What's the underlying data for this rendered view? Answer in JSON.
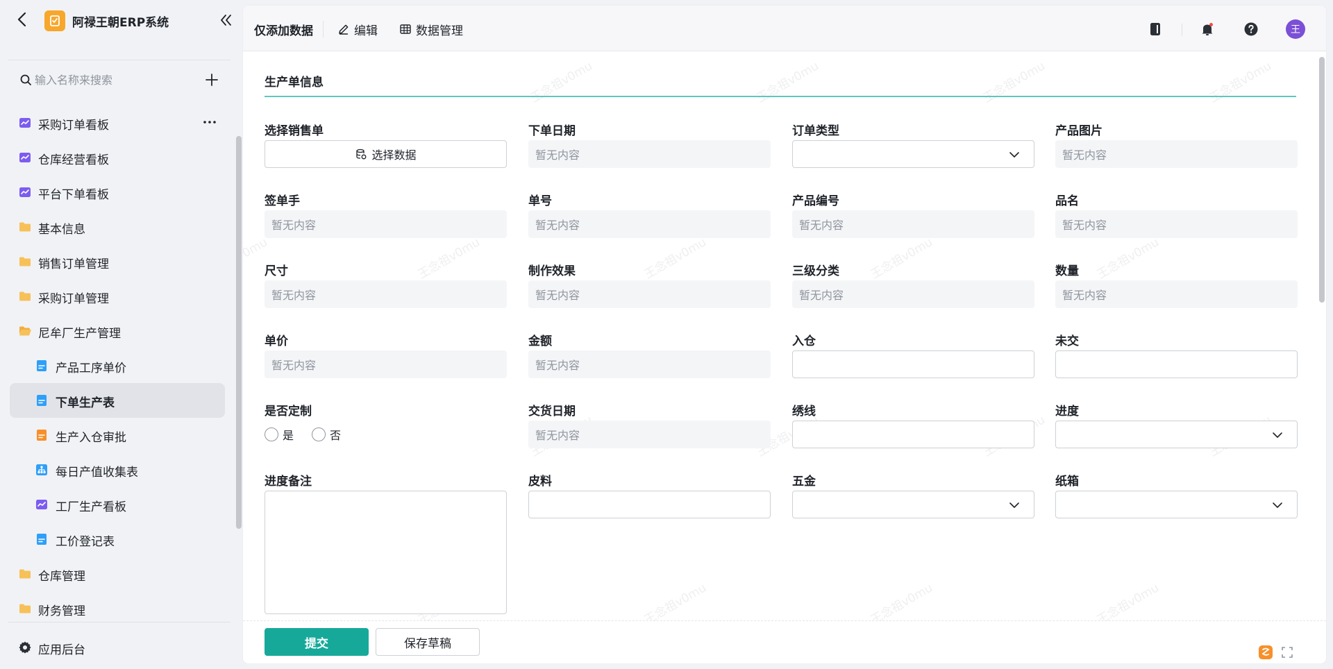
{
  "app": {
    "title": "阿禄王朝ERP系统"
  },
  "sidebar": {
    "search": {
      "placeholder": "输入名称来搜索"
    },
    "items": [
      {
        "label": "采购订单看板",
        "icon": "dashboard-icon"
      },
      {
        "label": "仓库经营看板",
        "icon": "dashboard-icon"
      },
      {
        "label": "平台下单看板",
        "icon": "dashboard-icon"
      },
      {
        "label": "基本信息",
        "icon": "folder-icon"
      },
      {
        "label": "销售订单管理",
        "icon": "folder-icon"
      },
      {
        "label": "采购订单管理",
        "icon": "folder-icon"
      },
      {
        "label": "尼牟厂生产管理",
        "icon": "folder-open-icon"
      },
      {
        "label": "产品工序单价",
        "icon": "form-icon"
      },
      {
        "label": "下单生产表",
        "icon": "form-icon",
        "active": true
      },
      {
        "label": "生产入仓审批",
        "icon": "approval-form-icon"
      },
      {
        "label": "每日产值收集表",
        "icon": "org-chart-icon"
      },
      {
        "label": "工厂生产看板",
        "icon": "dashboard-icon"
      },
      {
        "label": "工价登记表",
        "icon": "form-icon"
      },
      {
        "label": "仓库管理",
        "icon": "folder-icon"
      },
      {
        "label": "财务管理",
        "icon": "folder-icon"
      }
    ],
    "footer": {
      "label": "应用后台"
    }
  },
  "topbar": {
    "title": "仅添加数据",
    "edit_label": "编辑",
    "data_manage_label": "数据管理",
    "avatar_text": "王"
  },
  "form": {
    "section_title": "生产单信息",
    "empty_text": "暂无内容",
    "select_data_label": "选择数据",
    "fields": {
      "sales_order": "选择销售单",
      "order_date": "下单日期",
      "order_type": "订单类型",
      "product_image": "产品图片",
      "signer": "签单手",
      "order_no": "单号",
      "product_code": "产品编号",
      "product_name": "品名",
      "size": "尺寸",
      "effect": "制作效果",
      "category3": "三级分类",
      "quantity": "数量",
      "unit_price": "单价",
      "amount": "金额",
      "in_stock": "入仓",
      "undelivered": "未交",
      "customized": "是否定制",
      "delivery_date": "交货日期",
      "embroidery": "绣线",
      "progress": "进度",
      "progress_note": "进度备注",
      "leather": "皮料",
      "hardware": "五金",
      "carton": "纸箱"
    },
    "radio_yes": "是",
    "radio_no": "否",
    "submit_label": "提交",
    "draft_label": "保存草稿"
  },
  "watermark_text": "王念祖v0mu",
  "colors": {
    "accent": "#16a99a",
    "section_line": "#5fc6bf",
    "folder": "#f7c15a",
    "dashboard": "#7c5cf0",
    "form": "#2f9ff8",
    "approval": "#f7902b",
    "avatar": "#7b4fd6",
    "logo": "#f7a72b"
  }
}
